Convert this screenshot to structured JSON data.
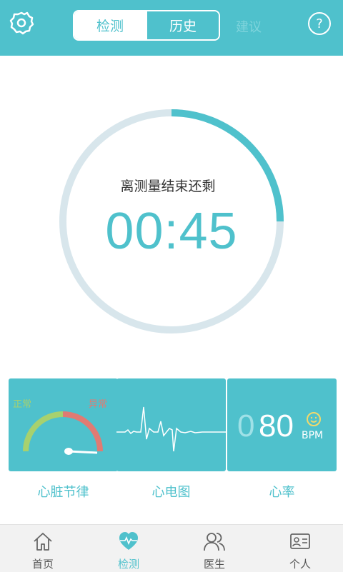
{
  "header": {
    "tabs": [
      {
        "label": "检测",
        "active": true
      },
      {
        "label": "历史",
        "active": false
      }
    ],
    "ghost_text": "建议",
    "colors": {
      "accent": "#4fc1cc",
      "white": "#ffffff"
    }
  },
  "timer": {
    "label": "离测量结束还剩",
    "value": "00:45",
    "progress": 0.25
  },
  "cards": [
    {
      "label": "心脏节律",
      "gauge_normal": "正常",
      "gauge_abnormal": "异常"
    },
    {
      "label": "心电图"
    },
    {
      "label": "心率",
      "value_prefix": "0",
      "value": "80",
      "unit": "BPM"
    }
  ],
  "nav": {
    "items": [
      {
        "label": "首页",
        "icon": "home-icon",
        "active": false
      },
      {
        "label": "检测",
        "icon": "heart-pulse-icon",
        "active": true
      },
      {
        "label": "医生",
        "icon": "doctors-icon",
        "active": false
      },
      {
        "label": "个人",
        "icon": "id-card-icon",
        "active": false
      }
    ]
  }
}
